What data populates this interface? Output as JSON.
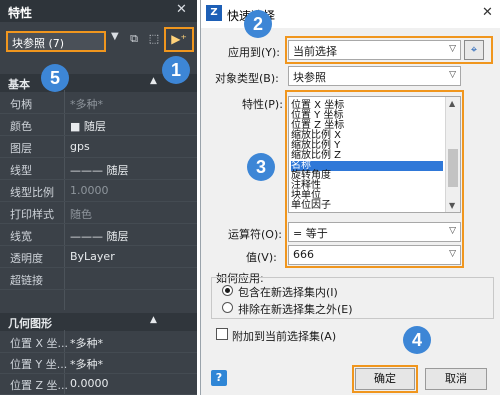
{
  "properties_panel": {
    "title": "特性",
    "close_glyph": "✕",
    "selection": {
      "value": "块参照 (7)",
      "arrow": "▼"
    },
    "toolbar": {
      "toggle_glyph": "⧉",
      "select_glyph": "⬚",
      "quick_select_glyph": "▶⁺"
    },
    "sections": [
      {
        "label": "基本",
        "triangle": "▲"
      },
      {
        "label": "几何图形",
        "triangle": "▲"
      }
    ],
    "basic_rows": [
      {
        "key": "句柄",
        "value": "*多种*"
      },
      {
        "key": "颜色",
        "value": "■ 随层"
      },
      {
        "key": "图层",
        "value": "gps"
      },
      {
        "key": "线型",
        "value": "——— 随层"
      },
      {
        "key": "线型比例",
        "value": "1.0000"
      },
      {
        "key": "打印样式",
        "value": "随色"
      },
      {
        "key": "线宽",
        "value": "——— 随层"
      },
      {
        "key": "透明度",
        "value": "ByLayer"
      },
      {
        "key": "超链接",
        "value": ""
      }
    ],
    "geometry_rows": [
      {
        "key": "位置 X 坐...",
        "value": "*多种*"
      },
      {
        "key": "位置 Y 坐...",
        "value": "*多种*"
      },
      {
        "key": "位置 Z 坐...",
        "value": "0.0000"
      }
    ]
  },
  "badges": [
    "1",
    "2",
    "3",
    "4",
    "5"
  ],
  "dialog": {
    "logo": "Z",
    "title": "快速选择",
    "close_glyph": "✕",
    "apply_to": {
      "label": "应用到(Y):",
      "value": "当前选择",
      "arrow": "▽",
      "pick_glyph": "⌖"
    },
    "object_type": {
      "label": "对象类型(B):",
      "value": "块参照",
      "arrow": "▽"
    },
    "properties": {
      "label": "特性(P):",
      "items": [
        "位置 X 坐标",
        "位置 Y 坐标",
        "位置 Z 坐标",
        "缩放比例 X",
        "缩放比例 Y",
        "缩放比例 Z",
        "名称",
        "旋转角度",
        "注释性",
        "块单位",
        "单位因子"
      ],
      "selected_index": 6,
      "scroll_up": "▲",
      "scroll_down": "▼"
    },
    "operator": {
      "label": "运算符(O):",
      "value": "= 等于",
      "arrow": "▽"
    },
    "value": {
      "label": "值(V):",
      "value": "666",
      "arrow": "▽"
    },
    "how_to_apply": {
      "label": "如何应用:",
      "options": [
        "包含在新选择集内(I)",
        "排除在新选择集之外(E)"
      ],
      "selected": 0
    },
    "append_checkbox": "附加到当前选择集(A)",
    "help_glyph": "?",
    "ok_label": "确定",
    "cancel_label": "取消"
  },
  "colors": {
    "highlight": "#f0961e",
    "badge": "#3d86d6",
    "selected_row": "#2f78d8",
    "panel_bg": "#3b4148"
  }
}
